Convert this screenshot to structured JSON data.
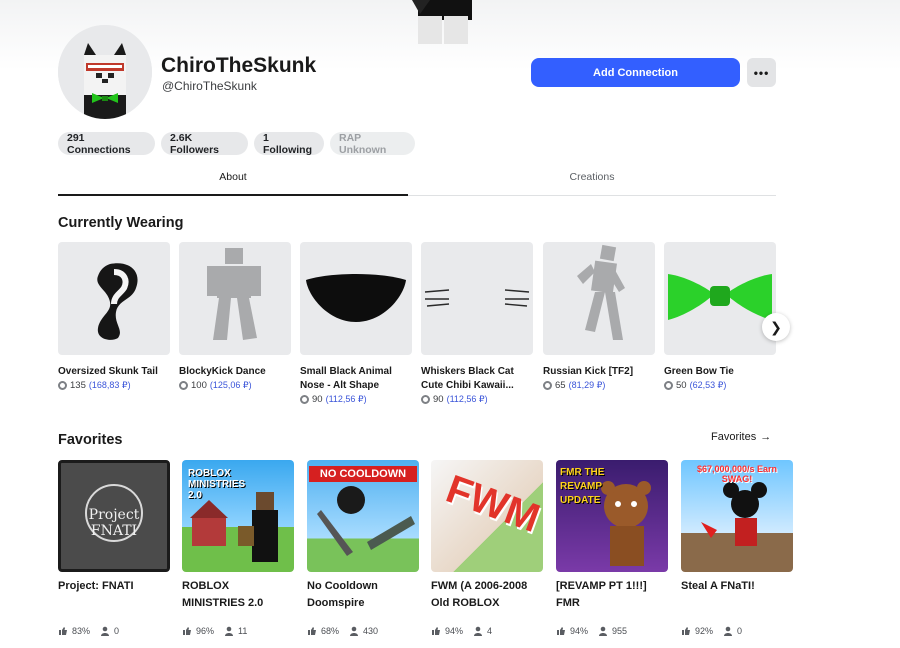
{
  "profile": {
    "display_name": "ChiroTheSkunk",
    "username": "@ChiroTheSkunk",
    "add_connection_label": "Add Connection",
    "more_label": "•••"
  },
  "stats": {
    "connections": "291 Connections",
    "followers": "2.6K Followers",
    "following": "1 Following",
    "rap": "RAP Unknown"
  },
  "tabs": {
    "about": "About",
    "creations": "Creations"
  },
  "wearing": {
    "title": "Currently Wearing",
    "items": [
      {
        "name": "Oversized Skunk Tail",
        "robux": "135",
        "local": "(168,83 ₽)"
      },
      {
        "name": "BlockyKick Dance",
        "robux": "100",
        "local": "(125,06 ₽)"
      },
      {
        "name": "Small Black Animal Nose - Alt Shape",
        "robux": "90",
        "local": "(112,56 ₽)"
      },
      {
        "name": "Whiskers Black Cat Cute Chibi Kawaii...",
        "robux": "90",
        "local": "(112,56 ₽)"
      },
      {
        "name": "Russian Kick [TF2]",
        "robux": "65",
        "local": "(81,29 ₽)"
      },
      {
        "name": "Green Bow Tie",
        "robux": "50",
        "local": "(62,53 ₽)"
      }
    ]
  },
  "favorites": {
    "title": "Favorites",
    "link_label": "Favorites",
    "games": [
      {
        "name": "Project: FNATI",
        "rating": "83%",
        "players": "0",
        "thumb_text": "Project FNATI"
      },
      {
        "name": "ROBLOX MINISTRIES 2.0",
        "rating": "96%",
        "players": "11",
        "thumb_text": "ROBLOX MINISTRIES 2.0"
      },
      {
        "name": "No Cooldown Doomspire",
        "rating": "68%",
        "players": "430",
        "thumb_text": "NO COOLDOWN"
      },
      {
        "name": "FWM (A 2006-2008 Old ROBLOX",
        "rating": "94%",
        "players": "4",
        "thumb_text": "FWM"
      },
      {
        "name": "[REVAMP PT 1!!!] FMR",
        "rating": "94%",
        "players": "955",
        "thumb_text": "FMR THE REVAMP UPDATE"
      },
      {
        "name": "Steal A FNaTI!",
        "rating": "92%",
        "players": "0",
        "thumb_text": "$67,000,000/s Earn SWAG!"
      }
    ]
  },
  "colors": {
    "accent": "#335fff",
    "pill_bg": "#e7e8ea",
    "thumb_bg": "#e9eaec",
    "local_price": "#3b55d9"
  }
}
